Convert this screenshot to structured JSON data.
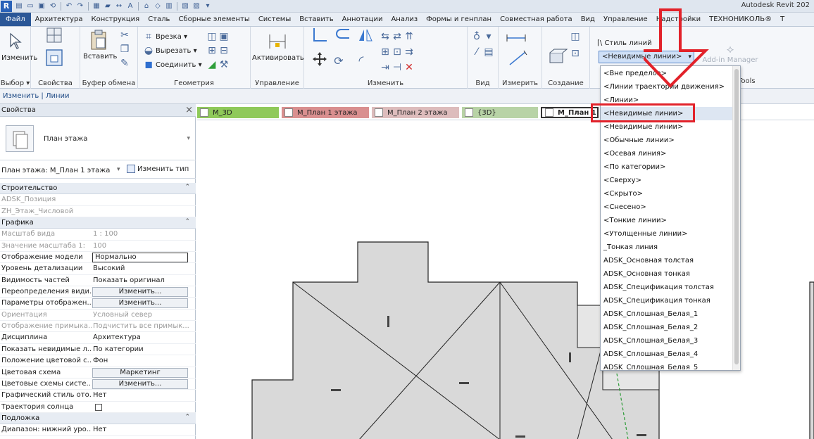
{
  "app": {
    "title": "Autodesk Revit 202"
  },
  "menu_tabs": [
    "Файл",
    "Архитектура",
    "Конструкция",
    "Сталь",
    "Сборные элементы",
    "Системы",
    "Вставить",
    "Аннотации",
    "Анализ",
    "Формы и генплан",
    "Совместная работа",
    "Вид",
    "Управление",
    "Надстройки",
    "ТЕХНОНИКОЛЬ®",
    "Т"
  ],
  "ribbon": {
    "modify_label": "Изменить",
    "panel_select": "Выбор ▾",
    "panel_properties": "Свойства",
    "panel_clipboard": "Буфер обмена",
    "paste_label": "Вставить",
    "cope_label": "Врезка ▾",
    "cut_label": "Вырезать ▾",
    "join_label": "Соединить ▾",
    "panel_geometry": "Геометрия",
    "activate_label": "Активировать",
    "panel_control": "Управление",
    "panel_modify": "Изменить",
    "panel_view": "Вид",
    "panel_measure": "Измерить",
    "panel_create": "Создание",
    "line_style_label": "Стиль линий",
    "line_style_value": "<Невидимые линии>",
    "addin_label": "Add-in Manager",
    "tools_label": "Tools"
  },
  "context_bar": {
    "label": "Изменить | Линии"
  },
  "properties": {
    "title": "Свойства",
    "type_name": "План этажа",
    "instance_name": "План этажа: М_План 1 этажа",
    "edit_type": "Изменить тип",
    "rows": [
      {
        "k": "Строительство",
        "v": "",
        "kind": "group"
      },
      {
        "k": "ADSK_Позиция",
        "v": "",
        "kind": "dim"
      },
      {
        "k": "ZH_Этаж_Числовой",
        "v": "",
        "kind": "dim"
      },
      {
        "k": "Графика",
        "v": "",
        "kind": "group"
      },
      {
        "k": "Масштаб вида",
        "v": "1 : 100",
        "kind": "dim"
      },
      {
        "k": "Значение масштаба  1:",
        "v": "100",
        "kind": "dim"
      },
      {
        "k": "Отображение модели",
        "v": "Нормально",
        "kind": "boxed"
      },
      {
        "k": "Уровень детализации",
        "v": "Высокий",
        "kind": "normal"
      },
      {
        "k": "Видимость частей",
        "v": "Показать оригинал",
        "kind": "normal"
      },
      {
        "k": "Переопределения види...",
        "v": "Изменить...",
        "kind": "button"
      },
      {
        "k": "Параметры отображен...",
        "v": "Изменить...",
        "kind": "button"
      },
      {
        "k": "Ориентация",
        "v": "Условный север",
        "kind": "dim"
      },
      {
        "k": "Отображение примыка...",
        "v": "Подчистить все примык...",
        "kind": "dim"
      },
      {
        "k": "Дисциплина",
        "v": "Архитектура",
        "kind": "normal"
      },
      {
        "k": "Показать невидимые л...",
        "v": "По категории",
        "kind": "normal"
      },
      {
        "k": "Положение цветовой с...",
        "v": "Фон",
        "kind": "normal"
      },
      {
        "k": "Цветовая схема",
        "v": "Маркетинг",
        "kind": "button"
      },
      {
        "k": "Цветовые схемы систе...",
        "v": "Изменить...",
        "kind": "button"
      },
      {
        "k": "Графический стиль ото...",
        "v": "Нет",
        "kind": "normal"
      },
      {
        "k": "Траектория солнца",
        "v": "",
        "kind": "check"
      },
      {
        "k": "Подложка",
        "v": "",
        "kind": "group"
      },
      {
        "k": "Диапазон: нижний уро...",
        "v": "Нет",
        "kind": "normal"
      }
    ]
  },
  "view_tabs": [
    {
      "label": "M_3D",
      "color": "#8fc95a",
      "active": false
    },
    {
      "label": "М_План 1 этажа",
      "color": "#d98f8f",
      "active": false
    },
    {
      "label": "М_План 2 этажа",
      "color": "#ddbcbc",
      "active": false
    },
    {
      "label": "{3D}",
      "color": "#b8d3a6",
      "active": false
    },
    {
      "label": "М_План 1",
      "color": "#ffffff",
      "active": true
    }
  ],
  "dropdown_items": [
    "<Вне пределов>",
    "<Линии траектории движения>",
    "<Линии>",
    "<Невидимые линии>",
    "<Невидимые линии>",
    "<Обычные линии>",
    "<Осевая линия>",
    "<По категории>",
    "<Сверху>",
    "<Скрыто>",
    "<Снесено>",
    "<Тонкие линии>",
    "<Утолщенные линии>",
    "_Тонкая линия",
    "ADSK_Основная толстая",
    "ADSK_Основная тонкая",
    "ADSK_Спецификация толстая",
    "ADSK_Спецификация тонкая",
    "ADSK_Сплошная_Белая_1",
    "ADSK_Сплошная_Белая_2",
    "ADSK_Сплошная_Белая_3",
    "ADSK_Сплошная_Белая_4",
    "ADSK_Сплошная_Белая_5"
  ],
  "colors": {
    "highlight": "#e2222a",
    "accent": "#2b5797"
  }
}
